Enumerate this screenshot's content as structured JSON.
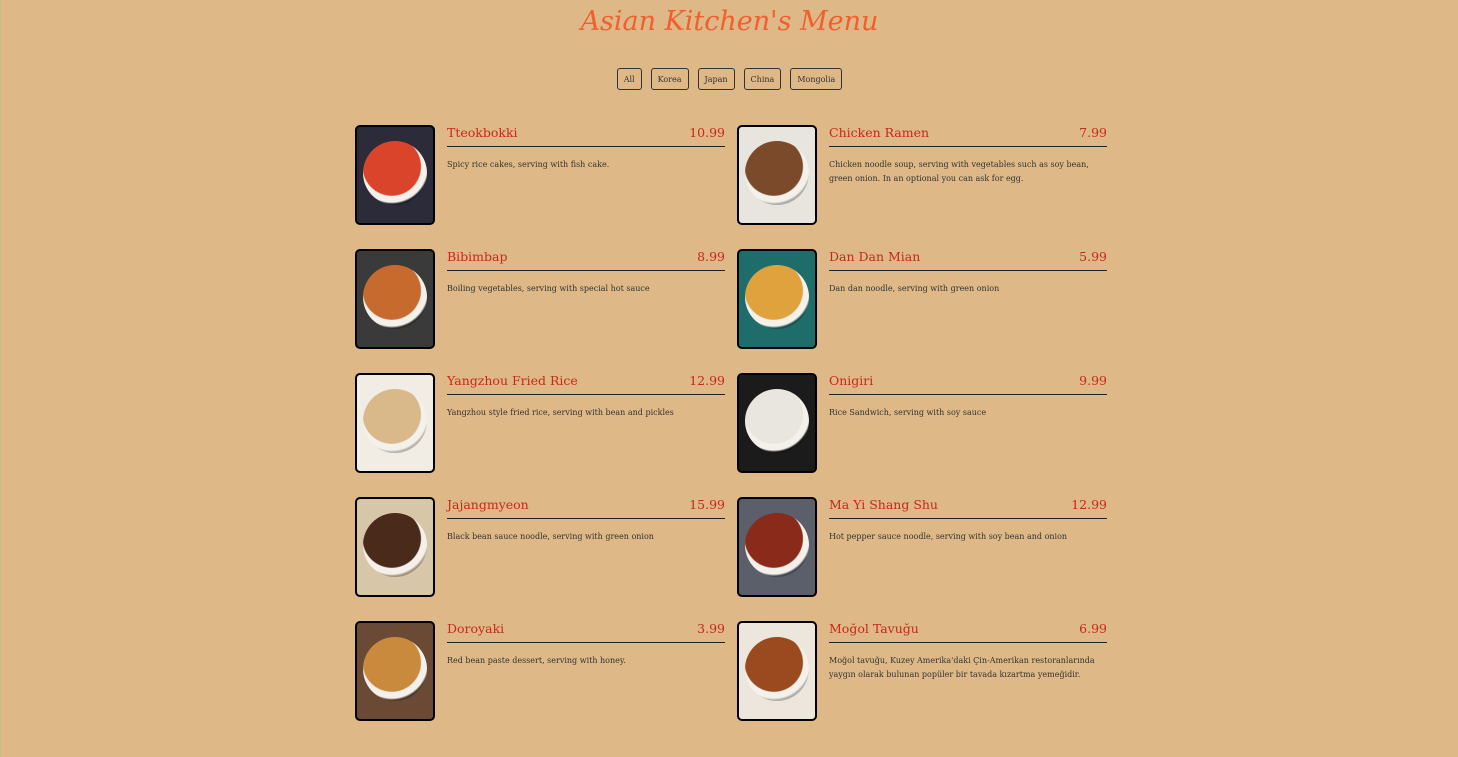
{
  "title": "Asian Kitchen's Menu",
  "filters": [
    "All",
    "Korea",
    "Japan",
    "China",
    "Mongolia"
  ],
  "items": [
    {
      "name": "Tteokbokki",
      "price": "10.99",
      "desc": "Spicy rice cakes, serving with fish cake.",
      "bg": "#2b2b3a",
      "dish": "#d9442a"
    },
    {
      "name": "Chicken Ramen",
      "price": "7.99",
      "desc": "Chicken noodle soup, serving with vegetables such as soy bean, green onion. In an optional you can ask for egg.",
      "bg": "#e8e4de",
      "dish": "#7a4a2a"
    },
    {
      "name": "Bibimbap",
      "price": "8.99",
      "desc": "Boiling vegetables, serving with special hot sauce",
      "bg": "#3a3a3a",
      "dish": "#c76a2e"
    },
    {
      "name": "Dan Dan Mian",
      "price": "5.99",
      "desc": "Dan dan noodle, serving with green onion",
      "bg": "#1f6d6b",
      "dish": "#e0a23c"
    },
    {
      "name": "Yangzhou Fried Rice",
      "price": "12.99",
      "desc": "Yangzhou style fried rice, serving with bean and pickles",
      "bg": "#f1ece4",
      "dish": "#d9b98a"
    },
    {
      "name": "Onigiri",
      "price": "9.99",
      "desc": "Rice Sandwich, serving with soy sauce",
      "bg": "#1b1b1b",
      "dish": "#e9e6e0"
    },
    {
      "name": "Jajangmyeon",
      "price": "15.99",
      "desc": "Black bean sauce noodle, serving with green onion",
      "bg": "#d8c6a8",
      "dish": "#4a2a1a"
    },
    {
      "name": "Ma Yi Shang Shu",
      "price": "12.99",
      "desc": "Hot pepper sauce noodle, serving with soy bean and onion",
      "bg": "#5a5f6a",
      "dish": "#8a2a1a"
    },
    {
      "name": "Doroyaki",
      "price": "3.99",
      "desc": "Red bean paste dessert, serving with honey.",
      "bg": "#6b4a35",
      "dish": "#c98a3e"
    },
    {
      "name": "Moğol Tavuğu",
      "price": "6.99",
      "desc": "Moğol tavuğu, Kuzey Amerika'daki Çin-Amerikan restoranlarında yaygın olarak bulunan popüler bir tavada kızartma yemeğidir.",
      "bg": "#ece6dc",
      "dish": "#9a4a1e"
    }
  ]
}
